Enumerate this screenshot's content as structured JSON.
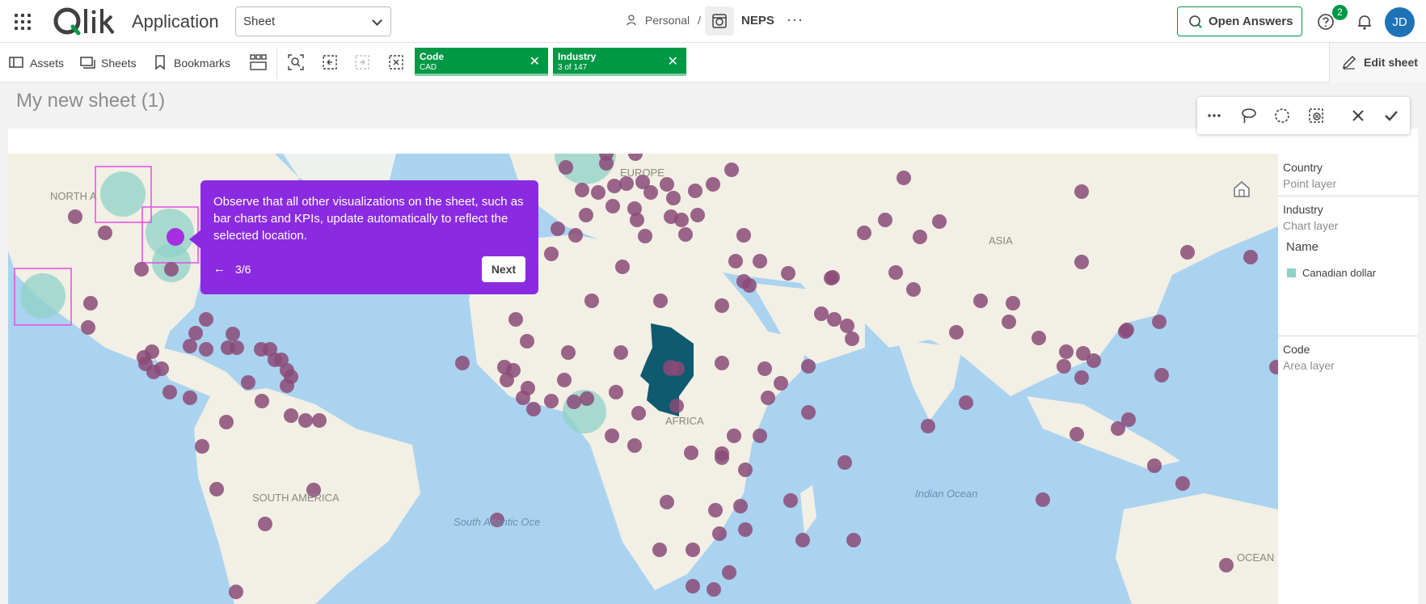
{
  "header": {
    "app_title": "Application",
    "sheet_select": "Sheet",
    "space": "Personal",
    "separator": "/",
    "app_name": "NEPS",
    "more": "···",
    "open_answers": "Open Answers",
    "notifications_count": "2",
    "user_initials": "JD"
  },
  "toolbar": {
    "assets": "Assets",
    "sheets": "Sheets",
    "bookmarks": "Bookmarks",
    "edit_sheet": "Edit sheet",
    "selections": [
      {
        "field": "Code",
        "value": "CAD"
      },
      {
        "field": "Industry",
        "value": "3 of 147"
      }
    ]
  },
  "sheet": {
    "title": "My new sheet (1)"
  },
  "map": {
    "labels": {
      "north_america": "NORTH A",
      "europe": "EUROPE",
      "asia": "ASIA",
      "africa": "AFRICA",
      "south_america": "SOUTH AMERICA",
      "oceania": "OCEAN"
    },
    "oceans": {
      "indian": "Indian Ocean",
      "south_atlantic": "South Atlantic Oce"
    },
    "colors": {
      "water": "#aad3f0",
      "land": "#f2efe4",
      "point": "#8b4a78",
      "chart_layer": "#8fd1c8",
      "area_highlight": "#0e5a6e",
      "lasso": "#e64ce6"
    }
  },
  "legend": {
    "layers": [
      {
        "name": "Country",
        "type": "Point layer"
      },
      {
        "name": "Industry",
        "type": "Chart layer"
      },
      {
        "name": "Code",
        "type": "Area layer"
      }
    ],
    "name_header": "Name",
    "items": [
      "Canadian dollar"
    ]
  },
  "tour": {
    "text": "Observe that all other visualizations on the sheet, such as bar charts and KPIs, update automatically to reflect the selected location.",
    "back": "←",
    "step": "3/6",
    "next": "Next",
    "color": "#8a2be2"
  }
}
